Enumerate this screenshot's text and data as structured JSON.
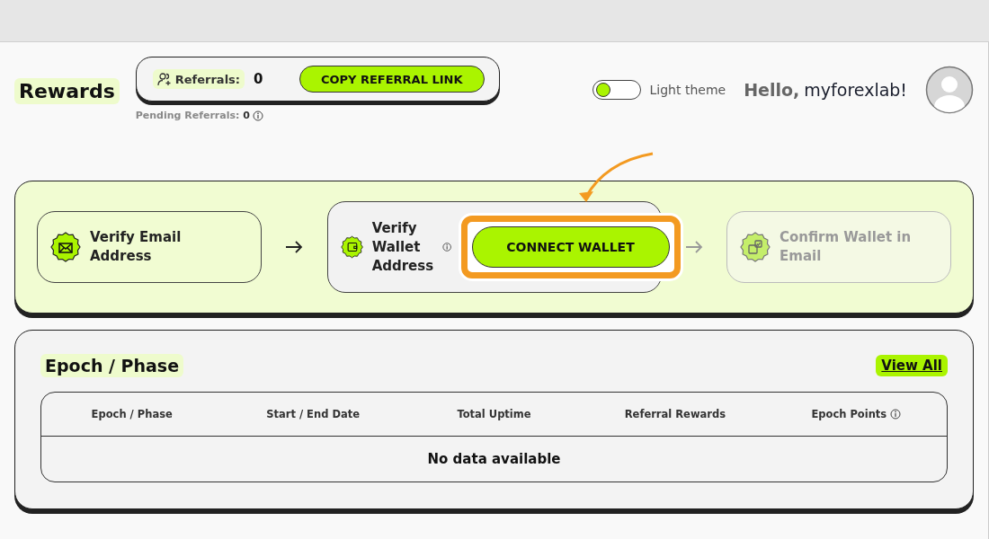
{
  "header": {
    "title": "Rewards",
    "referrals": {
      "label": "Referrals:",
      "count": "0",
      "button": "COPY REFERRAL LINK"
    },
    "pending": {
      "label": "Pending Referrals:",
      "count": "0"
    },
    "theme_toggle": {
      "label": "Light theme",
      "on": false
    },
    "greeting": {
      "prefix": "Hello,",
      "name": "myforexlab!"
    }
  },
  "steps": [
    {
      "kind": "email",
      "current": false,
      "disabled": false,
      "label": "Verify Email Address"
    },
    {
      "kind": "wallet",
      "current": true,
      "disabled": false,
      "label": "Verify Wallet Address",
      "info": true,
      "button": "CONNECT WALLET",
      "highlighted": true
    },
    {
      "kind": "confirm",
      "current": false,
      "disabled": true,
      "label": "Confirm Wallet in Email"
    }
  ],
  "epochs": {
    "title": "Epoch / Phase",
    "view_all": "View All",
    "columns": [
      {
        "label": "Epoch / Phase",
        "info": false
      },
      {
        "label": "Start / End Date",
        "info": false
      },
      {
        "label": "Total Uptime",
        "info": false
      },
      {
        "label": "Referral Rewards",
        "info": false
      },
      {
        "label": "Epoch Points",
        "info": true
      }
    ],
    "empty": "No data available"
  }
}
